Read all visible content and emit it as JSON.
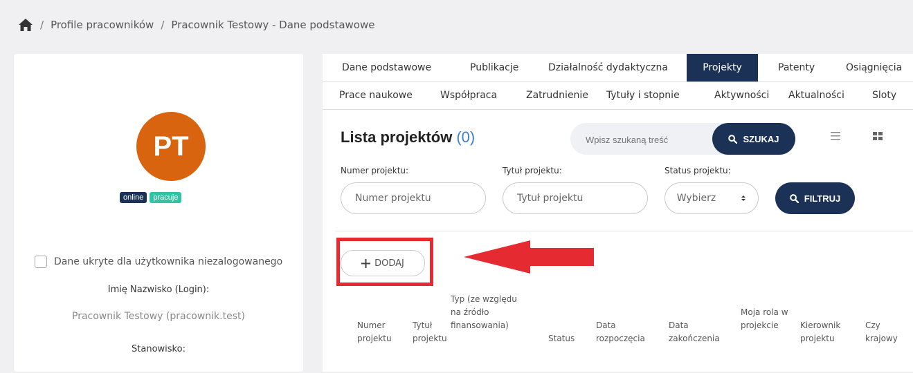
{
  "breadcrumb": {
    "items": [
      "Profile pracowników",
      "Pracownik Testowy - Dane podstawowe"
    ]
  },
  "profile": {
    "initials": "PT",
    "avatar_color": "#d96410",
    "badges": [
      {
        "label": "online",
        "color": "#1b3256"
      },
      {
        "label": "pracuje",
        "color": "#30c4a5"
      }
    ],
    "hidden_checkbox_label": "Dane ukryte dla użytkownika niezalogowanego",
    "name_label": "Imię Nazwisko (Login):",
    "name_value": "Pracownik Testowy (pracownik.test)",
    "position_label": "Stanowisko:"
  },
  "tabs": {
    "row1": [
      "Dane podstawowe",
      "Publikacje",
      "Działalność dydaktyczna",
      "Projekty",
      "Patenty",
      "Osiągnięcia"
    ],
    "row2": [
      "Prace naukowe",
      "Współpraca",
      "Zatrudnienie",
      "Tytuły i stopnie",
      "Aktywności",
      "Aktualności",
      "Sloty"
    ],
    "active": "Projekty"
  },
  "list": {
    "title": "Lista projektów",
    "count": "(0)",
    "search_placeholder": "Wpisz szukaną treść",
    "search_button": "SZUKAJ"
  },
  "filters": {
    "number_label": "Numer projektu:",
    "number_placeholder": "Numer projektu",
    "title_label": "Tytuł projektu:",
    "title_placeholder": "Tytuł projektu",
    "status_label": "Status projektu:",
    "status_value": "Wybierz",
    "filter_button": "FILTRUJ"
  },
  "add_button": "DODAJ",
  "table": {
    "columns": [
      "Numer projektu",
      "Tytuł projektu",
      "Typ (ze względu na źródło finansowania)",
      "Status",
      "Data rozpoczęcia",
      "Data zakończenia",
      "Moja rola w projekcie",
      "Kierownik projektu",
      "Czy krajowy"
    ]
  },
  "colors": {
    "primary": "#1b3256",
    "accent": "#3d7ed6",
    "highlight": "#e52b31"
  }
}
